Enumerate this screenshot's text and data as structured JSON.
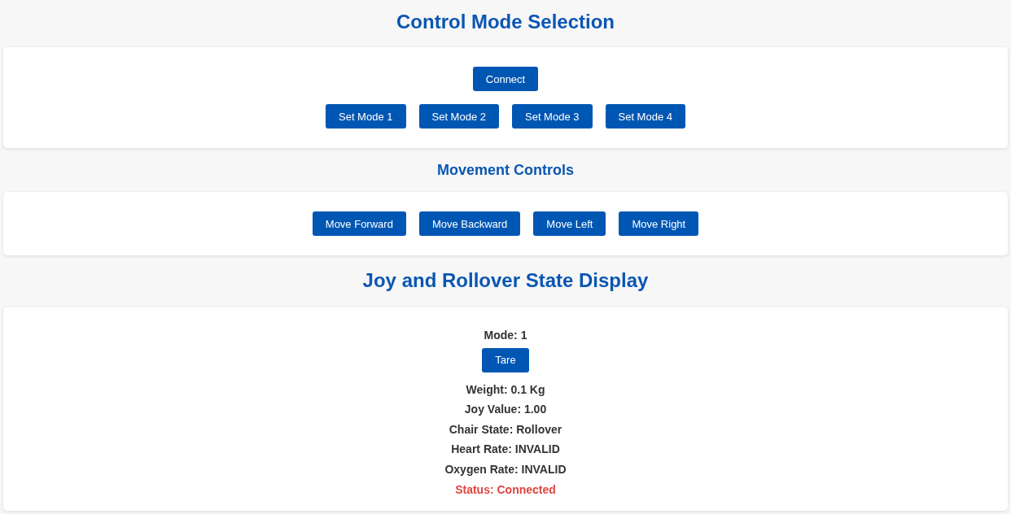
{
  "sections": [
    {
      "title": "Control Mode Selection",
      "kind": "main",
      "rows": [
        {
          "buttons": [
            "Connect"
          ]
        },
        {
          "buttons": [
            "Set Mode 1",
            "Set Mode 2",
            "Set Mode 3",
            "Set Mode 4"
          ]
        }
      ]
    },
    {
      "title": "Movement Controls",
      "kind": "sub",
      "rows": [
        {
          "buttons": [
            "Move Forward",
            "Move Backward",
            "Move Left",
            "Move Right"
          ]
        }
      ]
    },
    {
      "title": "Joy and Rollover State Display",
      "kind": "main",
      "items": [
        {
          "kind": "field",
          "text": "Mode: 1"
        },
        {
          "kind": "button",
          "text": "Tare"
        },
        {
          "kind": "field",
          "text": "Weight: 0.1 Kg"
        },
        {
          "kind": "field",
          "text": "Joy Value: 1.00"
        },
        {
          "kind": "field",
          "text": "Chair State: Rollover"
        },
        {
          "kind": "field",
          "text": "Heart Rate: INVALID"
        },
        {
          "kind": "field",
          "text": "Oxygen Rate: INVALID"
        },
        {
          "kind": "status",
          "text": "Status: Connected"
        }
      ]
    }
  ]
}
